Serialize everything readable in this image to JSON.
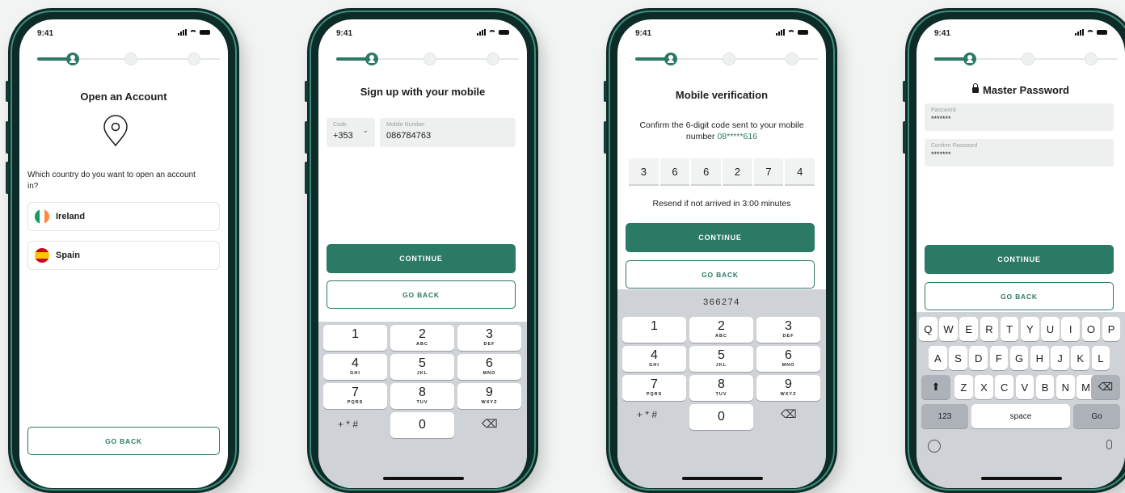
{
  "status_time": "9:41",
  "screen1": {
    "title": "Open an Account",
    "question": "Which country do you want to open an account in?",
    "options": [
      "Ireland",
      "Spain"
    ],
    "go_back": "GO BACK"
  },
  "screen2": {
    "title": "Sign up with your mobile",
    "code_label": "Code",
    "code_value": "+353",
    "mobile_label": "Mobile Number",
    "mobile_value": "086784763",
    "continue": "CONTINUE",
    "go_back": "GO BACK",
    "keys": [
      {
        "n": "1",
        "l": ""
      },
      {
        "n": "2",
        "l": "ABC"
      },
      {
        "n": "3",
        "l": "DEF"
      },
      {
        "n": "4",
        "l": "GHI"
      },
      {
        "n": "5",
        "l": "JKL"
      },
      {
        "n": "6",
        "l": "MNO"
      },
      {
        "n": "7",
        "l": "PQRS"
      },
      {
        "n": "8",
        "l": "TUV"
      },
      {
        "n": "9",
        "l": "WXYZ"
      }
    ],
    "symbols": "+ * #",
    "zero": "0"
  },
  "screen3": {
    "title": "Mobile verification",
    "info_prefix": "Confirm the 6-digit code sent to your mobile number",
    "masked_number": "08*****616",
    "digits": [
      "3",
      "6",
      "6",
      "2",
      "7",
      "4"
    ],
    "resend": "Resend if not arrived in 3:00 minutes",
    "continue": "CONTINUE",
    "go_back": "GO BACK",
    "suggestion": "366274"
  },
  "screen4": {
    "title": "Master Password",
    "password_label": "Password",
    "password_value": "*******",
    "confirm_label": "Confirm Password",
    "confirm_value": "*******",
    "continue": "CONTINUE",
    "go_back": "GO BACK",
    "row1": [
      "Q",
      "W",
      "E",
      "R",
      "T",
      "Y",
      "U",
      "I",
      "O",
      "P"
    ],
    "row2": [
      "A",
      "S",
      "D",
      "F",
      "G",
      "H",
      "J",
      "K",
      "L"
    ],
    "row3": [
      "Z",
      "X",
      "C",
      "V",
      "B",
      "N",
      "M"
    ],
    "k123": "123",
    "space": "space",
    "go": "Go"
  },
  "colors": {
    "brand": "#2b7a66",
    "frame": "#0d2c28"
  }
}
